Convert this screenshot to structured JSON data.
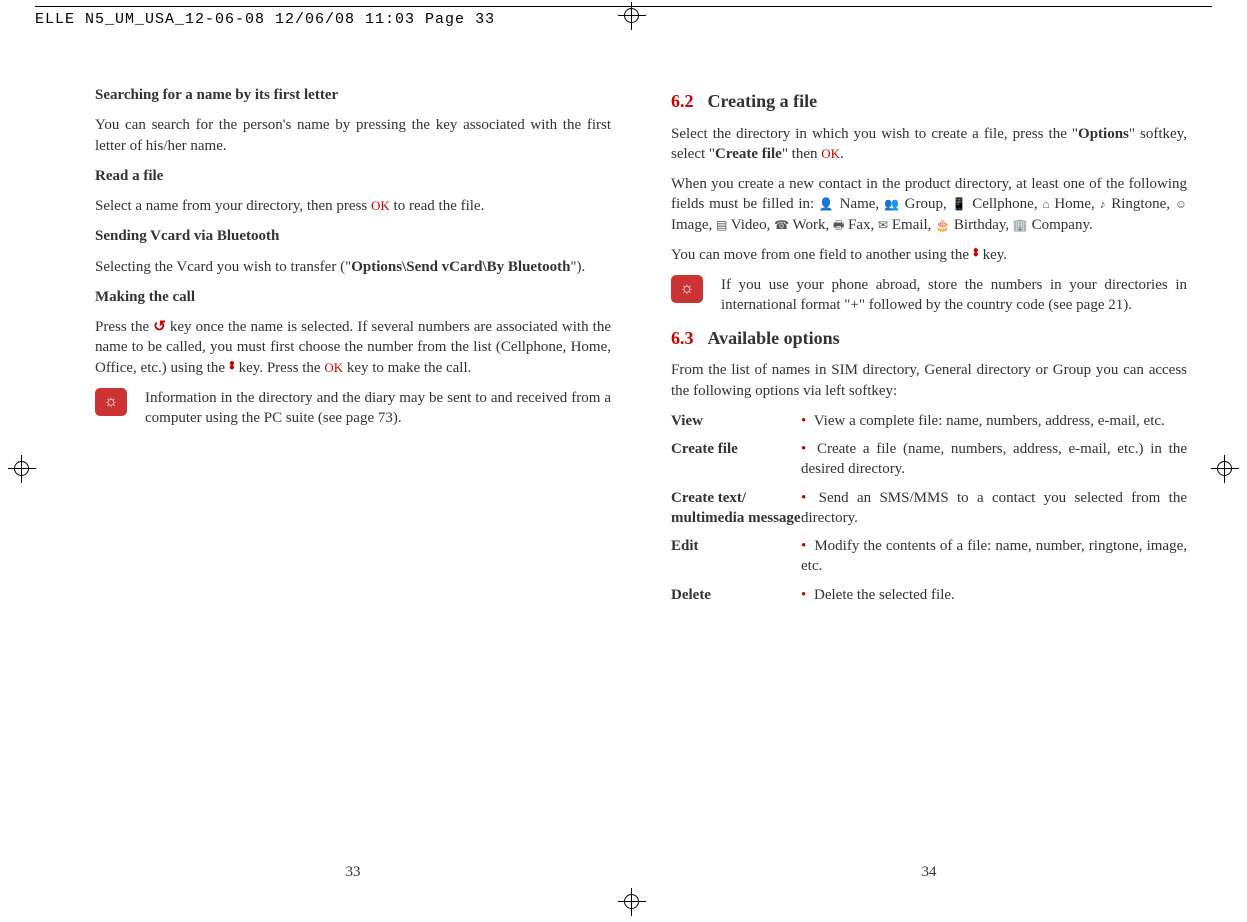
{
  "header": "ELLE N5_UM_USA_12-06-08  12/06/08  11:03  Page 33",
  "left": {
    "h1": "Searching for a name by its first letter",
    "p1": "You can search for the person's name by pressing the key associated with the first letter of his/her name.",
    "h2": "Read a file",
    "p2a": "Select a name from your directory, then press ",
    "p2b": " to read the file.",
    "h3": "Sending Vcard via Bluetooth",
    "p3a": "Selecting the Vcard you wish to transfer (\"",
    "p3b": "Options\\Send vCard\\By Bluetooth",
    "p3c": "\").",
    "h4": "Making the call",
    "p4a": "Press the ",
    "p4b": " key once the name is selected. If several numbers are associated with the name to be called, you must first choose the number from the list (Cellphone, Home, Office, etc.) using the ",
    "p4c": " key. Press the ",
    "p4d": " key to make the call.",
    "tip": "Information in the directory and the diary may be sent to and received from a computer using the PC suite (see page 73).",
    "pagenum": "33"
  },
  "right": {
    "s62num": "6.2",
    "s62title": "Creating a file",
    "p1a": "Select the directory in which you wish to create a file, press the \"",
    "p1b": "Options",
    "p1c": "\" softkey, select \"",
    "p1d": "Create file",
    "p1e": "\" then ",
    "p1f": ".",
    "p2a": "When you create a new contact in the product directory, at least one of the following fields must be filled in: ",
    "fields": " Name,  Group,  Cellphone,  Home,  Ringtone,  Image,  Video,  Work,  Fax,  Email,  Birthday,  Company.",
    "p3a": "You can move from one field to another using the ",
    "p3b": " key.",
    "tip": "If you use your phone abroad, store the numbers in your directories in international format \"+\" followed by the country code (see page 21).",
    "s63num": "6.3",
    "s63title": "Available options",
    "p4": "From the list of names in SIM directory, General directory or Group you can access the following options via left softkey:",
    "opts": [
      {
        "term": "View",
        "desc": "View a complete file: name, numbers, address, e-mail, etc."
      },
      {
        "term": "Create file",
        "desc": "Create a file (name, numbers, address, e-mail, etc.) in the desired directory."
      },
      {
        "term": "Create text/ multimedia message",
        "desc": "Send an SMS/MMS to a contact you selected from the directory."
      },
      {
        "term": "Edit",
        "desc": "Modify the contents of a file: name, number, ringtone, image, etc."
      },
      {
        "term": "Delete",
        "desc": "Delete the selected file."
      }
    ],
    "pagenum": "34"
  },
  "ok_label": "OK"
}
